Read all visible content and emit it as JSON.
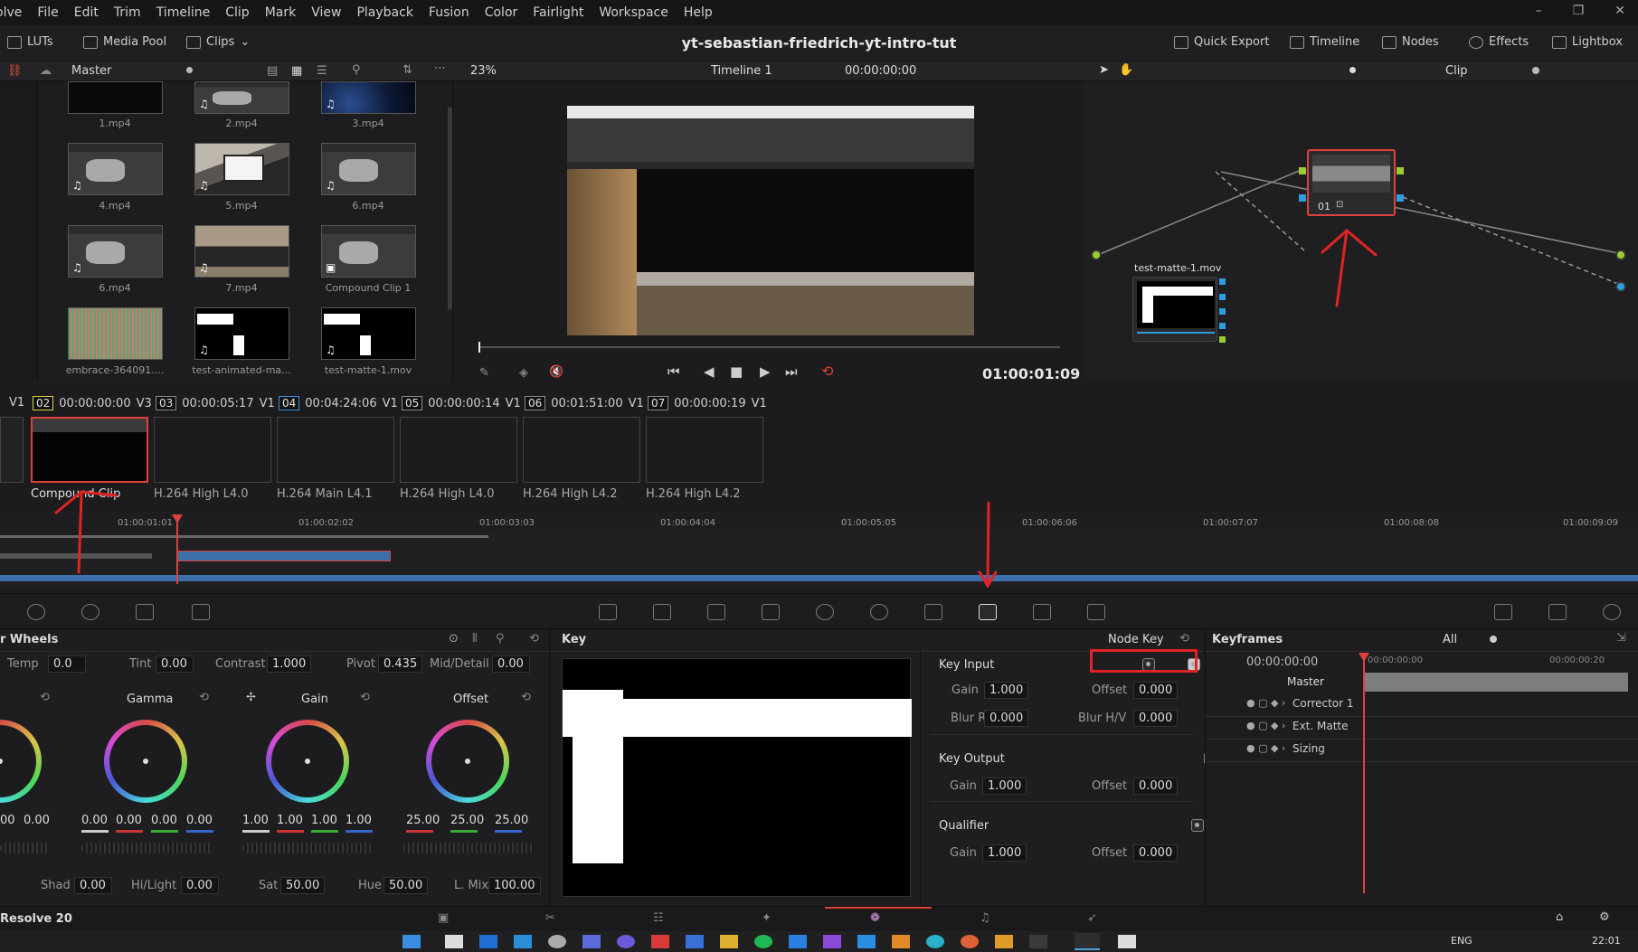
{
  "menu": [
    "olve",
    "File",
    "Edit",
    "Trim",
    "Timeline",
    "Clip",
    "Mark",
    "View",
    "Playback",
    "Fusion",
    "Color",
    "Fairlight",
    "Workspace",
    "Help"
  ],
  "window_controls": [
    "–",
    "❐",
    "✕"
  ],
  "toolbar": {
    "luts": "LUTs",
    "media_pool": "Media Pool",
    "clips": "Clips",
    "project_title": "yt-sebastian-friedrich-yt-intro-tut",
    "quick_export": "Quick Export",
    "timeline": "Timeline",
    "nodes": "Nodes",
    "effects": "Effects",
    "lightbox": "Lightbox"
  },
  "secondbar": {
    "bin": "Master",
    "zoom": "23%",
    "timeline_name": "Timeline 1",
    "timecode": "00:00:00:00",
    "clip_mode": "Clip"
  },
  "media_pool": {
    "items": [
      {
        "name": "1.mp4"
      },
      {
        "name": "2.mp4"
      },
      {
        "name": "3.mp4"
      },
      {
        "name": "4.mp4"
      },
      {
        "name": "5.mp4"
      },
      {
        "name": "6.mp4"
      },
      {
        "name": "6.mp4"
      },
      {
        "name": "7.mp4"
      },
      {
        "name": "Compound Clip 1"
      },
      {
        "name": "embrace-364091...."
      },
      {
        "name": "test-animated-ma..."
      },
      {
        "name": "test-matte-1.mov"
      }
    ]
  },
  "viewer": {
    "timecode": "01:00:01:09"
  },
  "nodes": {
    "node1_label": "01",
    "matte_label": "test-matte-1.mov"
  },
  "clips": [
    {
      "num": "02",
      "tc": "00:00:00:00",
      "track": "V3",
      "name": "Compound Clip"
    },
    {
      "num": "03",
      "tc": "00:00:05:17",
      "track": "V1",
      "name": "H.264 High L4.0"
    },
    {
      "num": "04",
      "tc": "00:04:24:06",
      "track": "V1",
      "name": "H.264 Main L4.1"
    },
    {
      "num": "05",
      "tc": "00:00:00:14",
      "track": "V1",
      "name": "H.264 High L4.0"
    },
    {
      "num": "06",
      "tc": "00:01:51:00",
      "track": "V1",
      "name": "H.264 High L4.2"
    },
    {
      "num": "07",
      "tc": "00:00:00:19",
      "track": "V1",
      "name": "H.264 High L4.2"
    }
  ],
  "first_track": "V1",
  "ruler": [
    "01:00:01:01",
    "01:00:02:02",
    "01:00:03:03",
    "01:00:04:04",
    "01:00:05:05",
    "01:00:06:06",
    "01:00:07:07",
    "01:00:08:08",
    "01:00:09:09"
  ],
  "wheels": {
    "title": "r Wheels",
    "temp_label": "Temp",
    "temp": "0.0",
    "tint_label": "Tint",
    "tint": "0.00",
    "contrast_label": "Contrast",
    "contrast": "1.000",
    "pivot_label": "Pivot",
    "pivot": "0.435",
    "middetail_label": "Mid/Detail",
    "middetail": "0.00",
    "gamma": "Gamma",
    "gain": "Gain",
    "offset": "Offset",
    "lift_vals": [
      "00",
      "0.00"
    ],
    "gamma_vals": [
      "0.00",
      "0.00",
      "0.00",
      "0.00"
    ],
    "gain_vals": [
      "1.00",
      "1.00",
      "1.00",
      "1.00"
    ],
    "offset_vals": [
      "25.00",
      "25.00",
      "25.00"
    ],
    "shad_label": "Shad",
    "shad": "0.00",
    "hilight_label": "Hi/Light",
    "hilight": "0.00",
    "sat_label": "Sat",
    "sat": "50.00",
    "hue_label": "Hue",
    "hue": "50.00",
    "lmix_label": "L. Mix",
    "lmix": "100.00"
  },
  "key": {
    "title": "Key",
    "mode": "Node Key",
    "key_input": "Key Input",
    "gain_label": "Gain",
    "offset_label": "Offset",
    "ki_gain": "1.000",
    "ki_offset": "0.000",
    "blur_r_label": "Blur R.",
    "blur_r": "0.000",
    "blur_hv_label": "Blur H/V",
    "blur_hv": "0.000",
    "key_output": "Key Output",
    "ko_gain": "1.000",
    "ko_offset": "0.000",
    "qualifier": "Qualifier",
    "q_gain": "1.000",
    "q_offset": "0.000"
  },
  "keyframes": {
    "title": "Keyframes",
    "filter": "All",
    "tc_current": "00:00:00:00",
    "tc_start": "00:00:00:00",
    "tc_end": "00:00:00:20",
    "rows": [
      "Master",
      "Corrector 1",
      "Ext. Matte",
      "Sizing"
    ]
  },
  "bottom": {
    "app": "Resolve 20"
  },
  "taskbar": {
    "lang": "ENG",
    "time": "22:01"
  },
  "colors": {
    "accent_red": "#e02424",
    "playhead": "#e0403a",
    "track_blue": "#3d6fa8"
  }
}
